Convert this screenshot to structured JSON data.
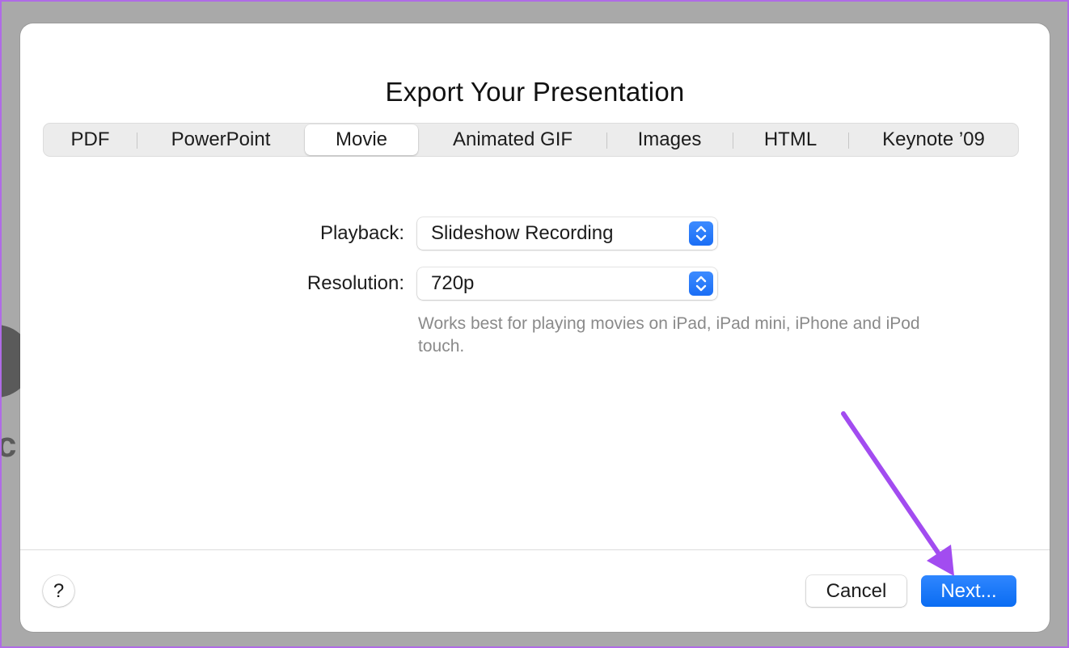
{
  "dialog": {
    "title": "Export Your Presentation"
  },
  "tabs": [
    {
      "label": "PDF",
      "active": false
    },
    {
      "label": "PowerPoint",
      "active": false
    },
    {
      "label": "Movie",
      "active": true
    },
    {
      "label": "Animated GIF",
      "active": false
    },
    {
      "label": "Images",
      "active": false
    },
    {
      "label": "HTML",
      "active": false
    },
    {
      "label": "Keynote ’09",
      "active": false
    }
  ],
  "form": {
    "playback_label": "Playback:",
    "playback_value": "Slideshow Recording",
    "resolution_label": "Resolution:",
    "resolution_value": "720p",
    "hint": "Works best for playing movies on iPad, iPad mini, iPhone and iPod touch."
  },
  "footer": {
    "help_label": "?",
    "cancel_label": "Cancel",
    "next_label": "Next..."
  },
  "colors": {
    "accent": "#0a6cf2",
    "annotation_arrow": "#a24cf0",
    "border": "#b06be6"
  },
  "icons": {
    "select_stepper": "up-down-chevron-icon",
    "annotation": "arrow-pointer-icon"
  }
}
